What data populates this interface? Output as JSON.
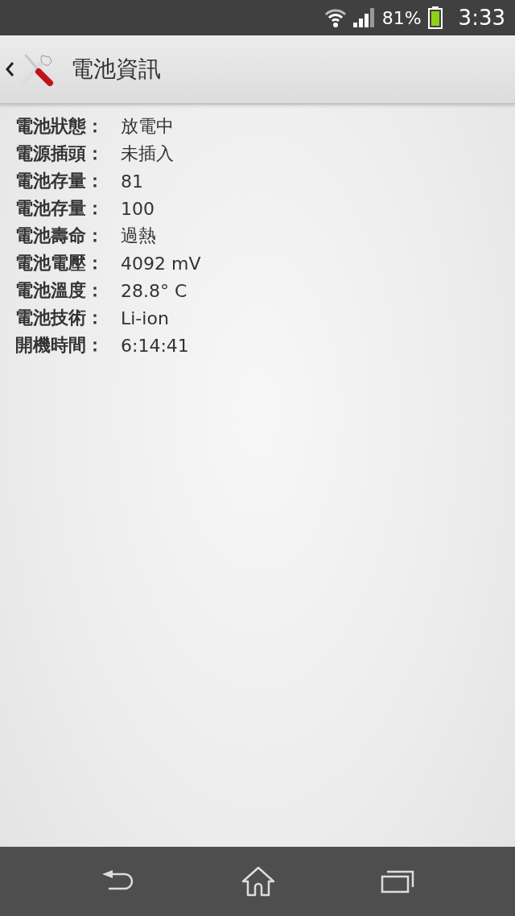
{
  "status_bar": {
    "battery": "81%",
    "time": "3:33"
  },
  "header": {
    "title": "電池資訊"
  },
  "info_rows": [
    {
      "label": "電池狀態：",
      "value": "放電中"
    },
    {
      "label": "電源插頭：",
      "value": "未插入"
    },
    {
      "label": "電池存量：",
      "value": "81"
    },
    {
      "label": "電池存量：",
      "value": "100"
    },
    {
      "label": "電池壽命：",
      "value": "過熱"
    },
    {
      "label": "電池電壓：",
      "value": "4092 mV"
    },
    {
      "label": "電池溫度：",
      "value": "28.8° C"
    },
    {
      "label": "電池技術：",
      "value": "Li-ion"
    },
    {
      "label": "開機時間：",
      "value": "6:14:41"
    }
  ]
}
